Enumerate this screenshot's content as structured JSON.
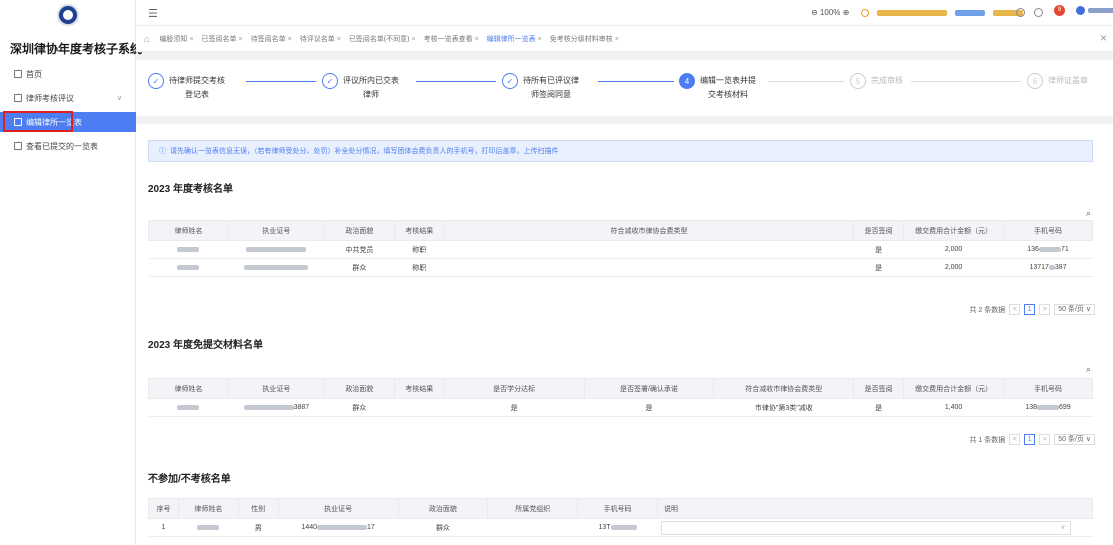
{
  "app": {
    "title": "深圳律协年度考核子系统"
  },
  "sidebar": {
    "items": [
      {
        "label": "首页"
      },
      {
        "label": "律师考核评议",
        "chevron": "∨"
      },
      {
        "label": "编辑律所一览表"
      },
      {
        "label": "查看已提交的一览表"
      }
    ]
  },
  "topbar": {
    "zoom": "⊖ 100% ⊕",
    "badge": "9"
  },
  "tabs": [
    {
      "label": "编股须知"
    },
    {
      "label": "已签阅名单"
    },
    {
      "label": "待签阅名单"
    },
    {
      "label": "待评议名单"
    },
    {
      "label": "已签阅名单(不同意)"
    },
    {
      "label": "考核一览表查看"
    },
    {
      "label": "编辑律所一览表"
    },
    {
      "label": "免考核分级材料审核"
    }
  ],
  "steps": [
    {
      "icon": "✓",
      "line1": "待律师提交考核",
      "line2": "登记表"
    },
    {
      "icon": "✓",
      "line1": "评议所内已交表",
      "line2": "律师"
    },
    {
      "icon": "✓",
      "line1": "待所有已评议律",
      "line2": "师签阅同意"
    },
    {
      "icon": "4",
      "line1": "编辑一览表并提",
      "line2": "交考核材料"
    },
    {
      "icon": "5",
      "line1": "完成审核",
      "line2": ""
    },
    {
      "icon": "6",
      "line1": "律师证盖章",
      "line2": ""
    }
  ],
  "info": {
    "text": "请先确认一览表信息无误，（若有律师受处分、处罚）补全处分情况，填写团体会费负责人的手机号，打印后盖章，上传扫描件"
  },
  "table1": {
    "title": "2023 年度考核名单",
    "headers": [
      "律师姓名",
      "执业证号",
      "政治面貌",
      "考核结果",
      "符合减收市律协会费类型",
      "是否签阅",
      "缴交费用合计金额（元）",
      "手机号码"
    ],
    "rows": [
      {
        "political": "中共党员",
        "result": "称职",
        "signed": "是",
        "amount": "2,000",
        "phone_prefix": "136",
        "phone_suffix": "71"
      },
      {
        "political": "群众",
        "result": "称职",
        "signed": "是",
        "amount": "2,000",
        "phone_prefix": "13717",
        "phone_suffix": "387"
      }
    ],
    "total": "共 2 条数据",
    "page": "1",
    "page_size": "50 条/页 ∨"
  },
  "table2": {
    "title": "2023 年度免提交材料名单",
    "headers": [
      "律师姓名",
      "执业证号",
      "政治面貌",
      "考核结果",
      "是否学分达标",
      "是否签署/确认承诺",
      "符合减收市律协会费类型",
      "是否签阅",
      "缴交费用合计金额（元）",
      "手机号码"
    ],
    "rows": [
      {
        "license_suffix": "3887",
        "political": "群众",
        "credit": "是",
        "promise": "是",
        "fee_type": "市律协\"第3类\"减收",
        "signed": "是",
        "amount": "1,400",
        "phone_prefix": "138",
        "phone_suffix": "699"
      }
    ],
    "total": "共 1 条数据",
    "page": "1",
    "page_size": "50 条/页 ∨"
  },
  "table3": {
    "title": "不参加/不考核名单",
    "headers": [
      "序号",
      "律师姓名",
      "性别",
      "执业证号",
      "政治面貌",
      "所属党组织",
      "手机号码",
      "说明"
    ],
    "rows": [
      {
        "index": "1",
        "gender": "男",
        "license_prefix": "1440",
        "license_suffix": "17",
        "political": "群众",
        "phone_prefix": "13T",
        "select_arrow": "∨"
      }
    ]
  },
  "colors": {
    "accent": "#4d7df2",
    "highlight": "#e02020"
  }
}
